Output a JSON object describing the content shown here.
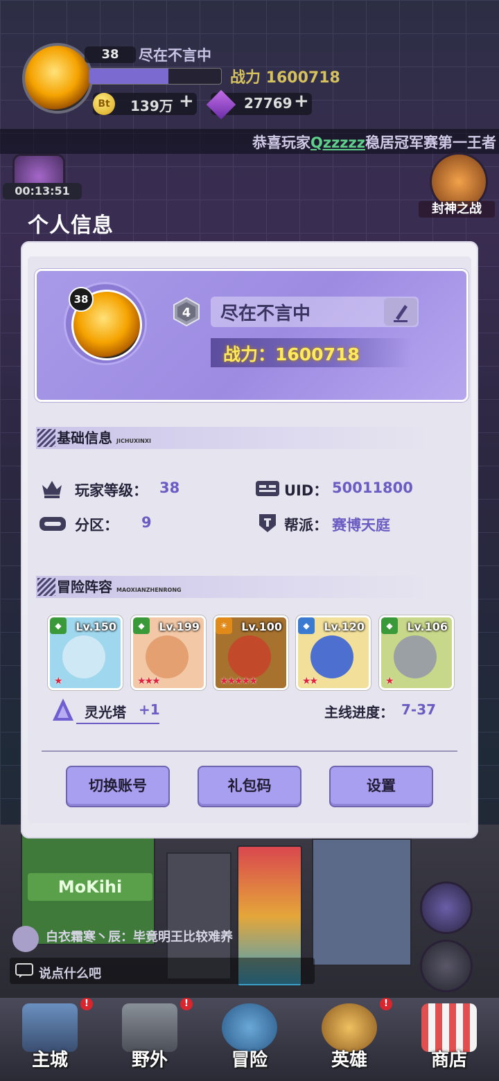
{
  "hud": {
    "level": "38",
    "player_name": "尽在不言中",
    "power": "战力 1600718",
    "exp_progress": 0.6,
    "coin_icon": "Bt",
    "coins": "139万",
    "gems": "27769",
    "plus": "+"
  },
  "ticker": {
    "prefix": "恭喜玩家",
    "player": "Qzzzzz",
    "suffix": "稳居冠军赛第一王者"
  },
  "side": {
    "timer": "00:13:51",
    "event_label": "封神之战"
  },
  "dialog": {
    "title": "个人信息",
    "avatar_level": "38",
    "rank_number": "4",
    "name": "尽在不言中",
    "power": "战力：1600718"
  },
  "basic": {
    "title": "基础信息",
    "subtitle": "JICHUXINXI",
    "player_level_label": "玩家等级：",
    "player_level": "38",
    "uid_label": "UID：",
    "uid": "50011800",
    "zone_label": "分区：",
    "zone": "9",
    "guild_label": "帮派：",
    "guild": "赛博天庭"
  },
  "lineup": {
    "title": "冒险阵容",
    "subtitle": "MAOXIANZHENRONG",
    "heroes": [
      {
        "level": "Lv.150",
        "stars": 1,
        "element": "green",
        "bg": "#9fd7ee",
        "face": "#cfe8f5"
      },
      {
        "level": "Lv.199",
        "stars": 3,
        "element": "green",
        "bg": "#f3c8a6",
        "face": "#e4a070"
      },
      {
        "level": "Lv.100",
        "stars": 5,
        "element": "orange",
        "bg": "#a6722e",
        "face": "#c24a2a"
      },
      {
        "level": "Lv.120",
        "stars": 2,
        "element": "blue",
        "bg": "#f2e09a",
        "face": "#4c6fd0"
      },
      {
        "level": "Lv.106",
        "stars": 1,
        "element": "green",
        "bg": "#c8d88a",
        "face": "#9aa0a4"
      }
    ],
    "tower_label": "灵光塔",
    "tower_bonus": "+1",
    "progress_label": "主线进度：",
    "progress": "7-37"
  },
  "buttons": {
    "switch_account": "切换账号",
    "gift_code": "礼包码",
    "settings": "设置"
  },
  "chat": {
    "line": "白衣霜寒丶辰：毕竟明王比较难养",
    "placeholder": "说点什么吧"
  },
  "nav": [
    {
      "label": "主城",
      "badge": "!"
    },
    {
      "label": "野外",
      "badge": "!"
    },
    {
      "label": "冒险",
      "badge": ""
    },
    {
      "label": "英雄",
      "badge": "!"
    },
    {
      "label": "商店",
      "badge": ""
    }
  ],
  "street_sign": "MoKihi"
}
